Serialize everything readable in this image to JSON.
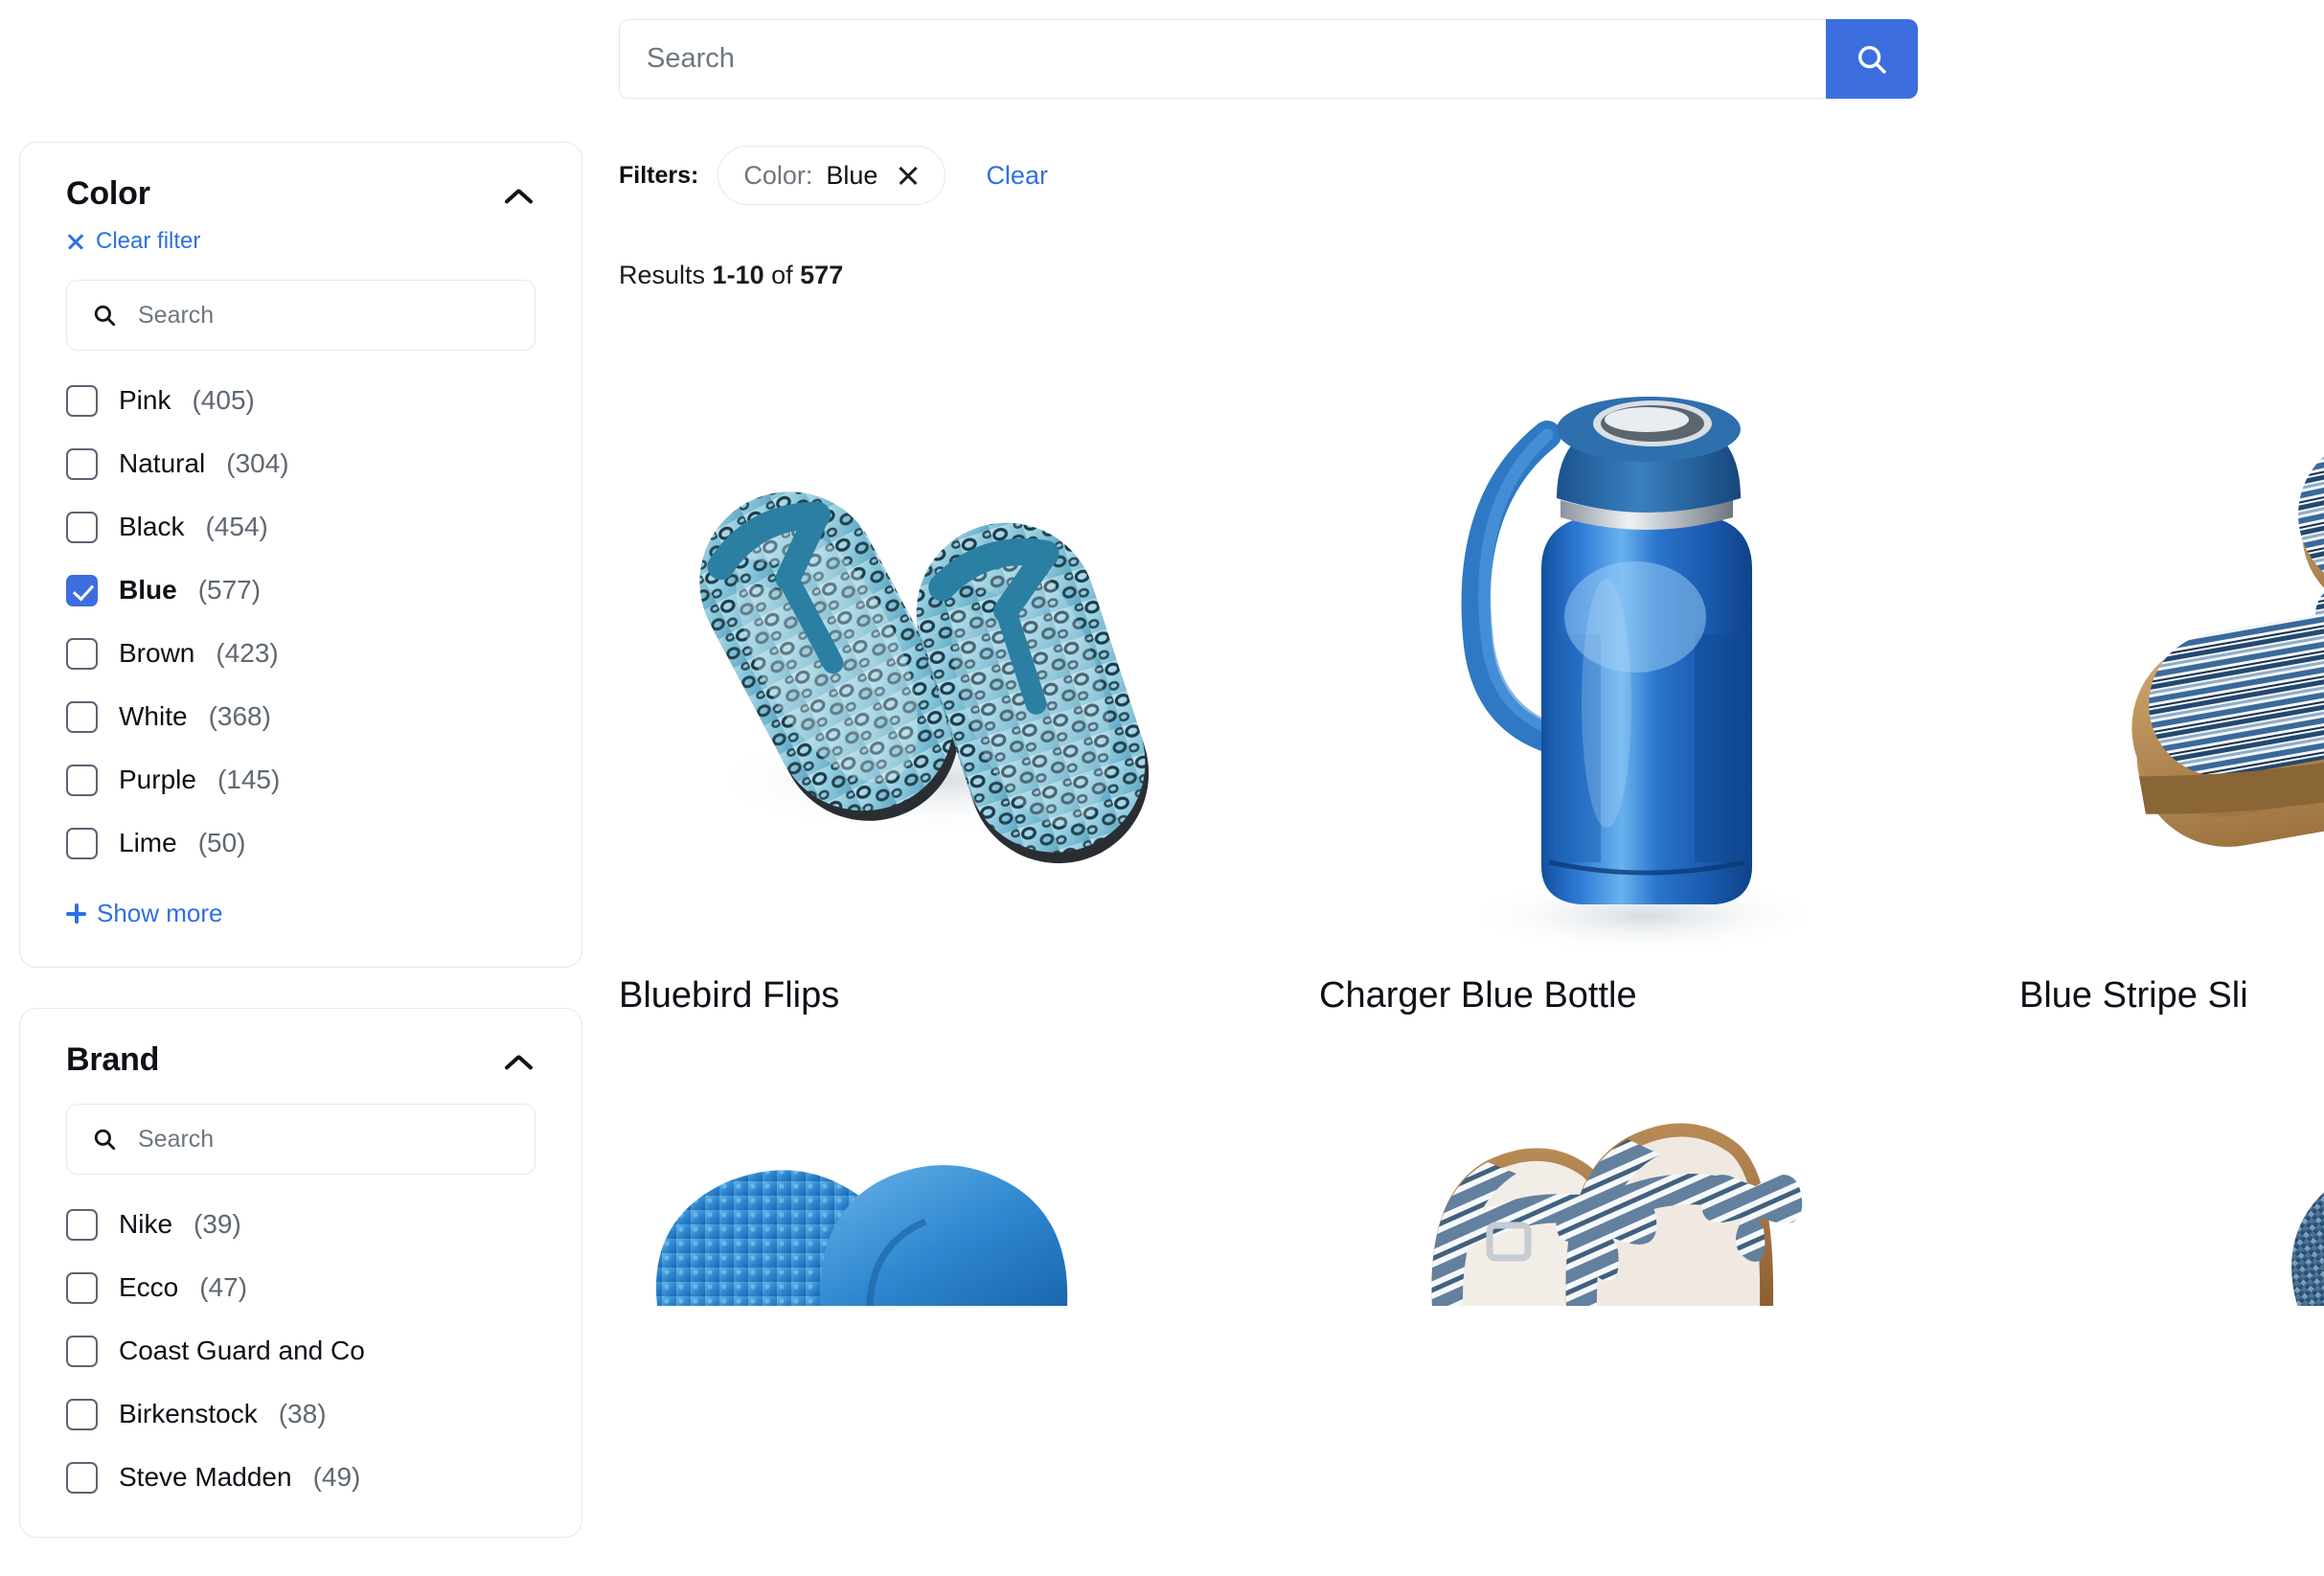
{
  "search": {
    "placeholder": "Search",
    "value": "",
    "button_icon": "search-icon"
  },
  "filters": {
    "label": "Filters:",
    "chips": [
      {
        "key": "Color:",
        "value": "Blue",
        "remove_icon": "close-icon"
      }
    ],
    "clear_label": "Clear"
  },
  "results": {
    "prefix": "Results",
    "range": "1-10",
    "middle": "of",
    "total": "577"
  },
  "facets": [
    {
      "title": "Color",
      "collapse_icon": "chevron-up-icon",
      "clear_filter_label": "Clear filter",
      "search_placeholder": "Search",
      "search_value": "",
      "options": [
        {
          "label": "Pink",
          "count": "(405)",
          "checked": false
        },
        {
          "label": "Natural",
          "count": "(304)",
          "checked": false
        },
        {
          "label": "Black",
          "count": "(454)",
          "checked": false
        },
        {
          "label": "Blue",
          "count": "(577)",
          "checked": true
        },
        {
          "label": "Brown",
          "count": "(423)",
          "checked": false
        },
        {
          "label": "White",
          "count": "(368)",
          "checked": false
        },
        {
          "label": "Purple",
          "count": "(145)",
          "checked": false
        },
        {
          "label": "Lime",
          "count": "(50)",
          "checked": false
        }
      ],
      "show_more_label": "Show more"
    },
    {
      "title": "Brand",
      "collapse_icon": "chevron-up-icon",
      "search_placeholder": "Search",
      "search_value": "",
      "options": [
        {
          "label": "Nike",
          "count": "(39)",
          "checked": false
        },
        {
          "label": "Ecco",
          "count": "(47)",
          "checked": false
        },
        {
          "label": "Coast Guard and Co",
          "count": "",
          "checked": false
        },
        {
          "label": "Birkenstock",
          "count": "(38)",
          "checked": false
        },
        {
          "label": "Steve Madden",
          "count": "(49)",
          "checked": false
        }
      ]
    }
  ],
  "products": {
    "row1": [
      {
        "name": "Bluebird Flips",
        "art": "flipflops-leopard"
      },
      {
        "name": "Charger Blue Bottle",
        "art": "bottle-blue"
      },
      {
        "name": "Blue Stripe Sli",
        "art": "slide-striped"
      }
    ],
    "row2": [
      {
        "name": "",
        "art": "clog-blue"
      },
      {
        "name": "",
        "art": "sandal-striped-bow"
      },
      {
        "name": "",
        "art": "flipflop-navy"
      }
    ]
  },
  "colors": {
    "accent": "#3c6ee0",
    "link": "#2f6fe4",
    "text": "#0d1117",
    "muted": "#6e7680",
    "border": "#e6e8eb"
  }
}
